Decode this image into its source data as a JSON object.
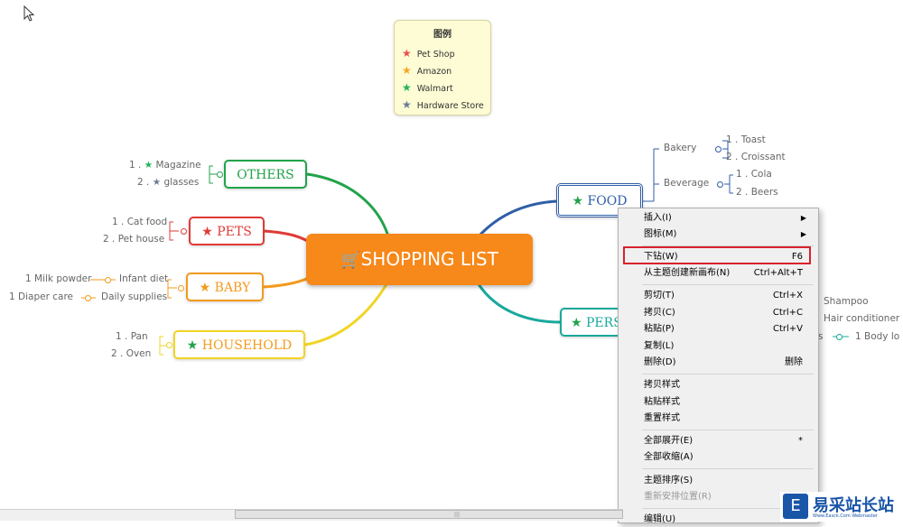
{
  "legend": {
    "title": "图例",
    "items": [
      {
        "label": "Pet Shop",
        "color": "#e8504e"
      },
      {
        "label": "Amazon",
        "color": "#f5a623"
      },
      {
        "label": "Walmart",
        "color": "#21b35a"
      },
      {
        "label": "Hardware Store",
        "color": "#6b7a99"
      }
    ]
  },
  "central": {
    "label": "SHOPPING LIST",
    "icon": "shopping-cart-icon"
  },
  "topics": {
    "others": {
      "label": "OTHERS",
      "color": "#21a34a",
      "items": [
        {
          "text": "1 . ",
          "star": "Magazine"
        },
        {
          "text": "2 . ",
          "star": "glasses"
        }
      ]
    },
    "pets": {
      "label": "PETS",
      "color": "#e03a36",
      "items": [
        "1 . Cat food",
        "2 . Pet house"
      ]
    },
    "baby": {
      "label": "BABY",
      "color": "#f39a1e",
      "items": [
        {
          "left": "1 Milk powder",
          "right": "Infant diet"
        },
        {
          "left": "1 Diaper care",
          "right": "Daily supplies"
        }
      ]
    },
    "household": {
      "label": "HOUSEHOLD",
      "color": "#f2d424",
      "items": [
        "1 . Pan",
        "2 . Oven"
      ]
    },
    "food": {
      "label": "FOOD",
      "color": "#2f5ea8",
      "groups": [
        {
          "name": "Bakery",
          "items": [
            "1 . Toast",
            "2 . Croissant"
          ]
        },
        {
          "name": "Beverage",
          "items": [
            "1 . Cola",
            "2 . Beers"
          ]
        }
      ]
    },
    "personal": {
      "label": "PERS",
      "color": "#1aa89c",
      "items": [
        "Shampoo",
        "Hair conditioner",
        "s",
        "1 Body lo"
      ]
    }
  },
  "context_menu": {
    "items": [
      {
        "label": "插入(I)",
        "submenu": true
      },
      {
        "label": "图标(M)",
        "submenu": true
      },
      {
        "label": "下钻(W)",
        "shortcut": "F6",
        "highlighted": true
      },
      {
        "label": "从主题创建新画布(N)",
        "shortcut": "Ctrl+Alt+T"
      },
      {
        "label": "剪切(T)",
        "shortcut": "Ctrl+X"
      },
      {
        "label": "拷贝(C)",
        "shortcut": "Ctrl+C"
      },
      {
        "label": "粘贴(P)",
        "shortcut": "Ctrl+V"
      },
      {
        "label": "复制(L)"
      },
      {
        "label": "删除(D)",
        "shortcut": "删除"
      },
      {
        "label": "拷贝样式"
      },
      {
        "label": "粘贴样式"
      },
      {
        "label": "重置样式"
      },
      {
        "label": "全部展开(E)",
        "shortcut": "*"
      },
      {
        "label": "全部收缩(A)"
      },
      {
        "label": "主题排序(S)"
      },
      {
        "label": "重新安排位置(R)",
        "disabled": true
      },
      {
        "label": "编辑(U)"
      }
    ]
  },
  "watermark": {
    "text": "易采站长站",
    "sub": "Www.Easck.Com Webmaster"
  }
}
